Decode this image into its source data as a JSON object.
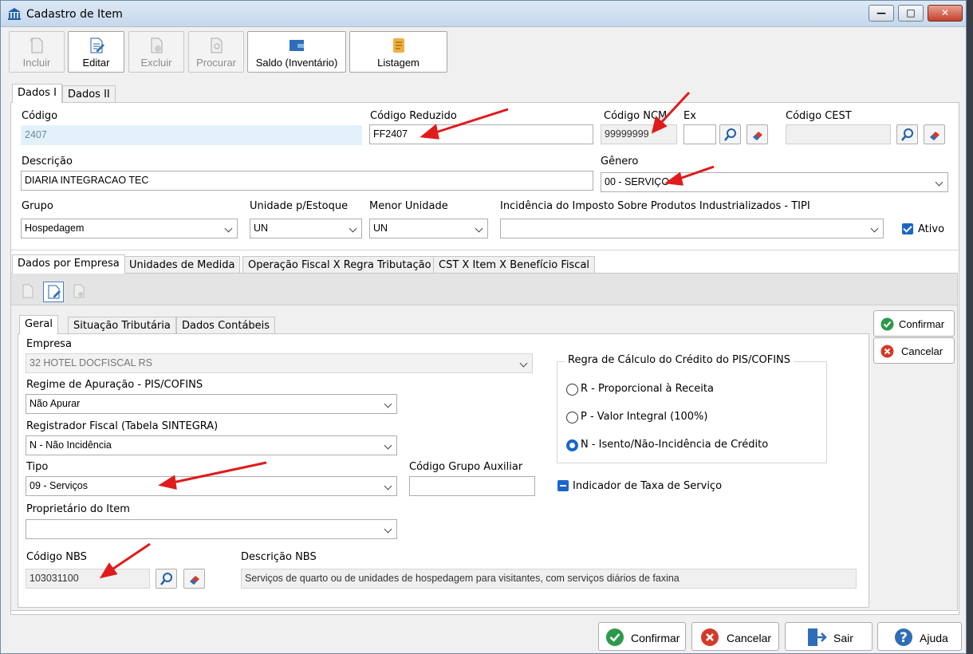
{
  "window": {
    "title": "Cadastro de Item"
  },
  "toolbar": {
    "incluir": "Incluir",
    "editar": "Editar",
    "excluir": "Excluir",
    "procurar": "Procurar",
    "saldo": "Saldo (Inventário)",
    "listagem": "Listagem"
  },
  "tabs_top": {
    "dados1": "Dados I",
    "dados2": "Dados II"
  },
  "form": {
    "codigo_label": "Código",
    "codigo": "2407",
    "cod_reduzido_label": "Código Reduzido",
    "cod_reduzido": "FF2407",
    "ncm_label": "Código NCM",
    "ncm": "99999999",
    "ex_label": "Ex",
    "ex": "",
    "cest_label": "Código CEST",
    "cest": "",
    "descricao_label": "Descrição",
    "descricao": "DIARIA INTEGRACAO TEC",
    "genero_label": "Gênero",
    "genero": "00 - SERVIÇO",
    "grupo_label": "Grupo",
    "grupo": "Hospedagem",
    "unidade_label": "Unidade p/Estoque",
    "unidade": "UN",
    "menor_label": "Menor Unidade",
    "menor": "UN",
    "tipi_label": "Incidência do Imposto Sobre Produtos Industrializados - TIPI",
    "tipi": "",
    "ativo_label": "Ativo",
    "ativo": true
  },
  "tabs_mid": [
    "Dados por Empresa",
    "Unidades de Medida",
    "Operação Fiscal X Regra Tributação",
    "CST X Item X Benefício Fiscal"
  ],
  "tabs_inner": [
    "Geral",
    "Situação Tributária",
    "Dados Contábeis"
  ],
  "geral": {
    "empresa_label": "Empresa",
    "empresa": "32 HOTEL DOCFISCAL RS",
    "regime_label": "Regime de Apuração - PIS/COFINS",
    "regime": "Não Apurar",
    "registrador_label": "Registrador Fiscal (Tabela SINTEGRA)",
    "registrador": "N - Não Incidência",
    "tipo_label": "Tipo",
    "tipo": "09 - Serviços",
    "grupo_aux_label": "Código Grupo Auxiliar",
    "grupo_aux": "",
    "proprietario_label": "Proprietário do Item",
    "proprietario": "",
    "nbs_label": "Código NBS",
    "nbs": "103031100",
    "desc_nbs_label": "Descrição NBS",
    "desc_nbs": "Serviços de quarto ou de unidades de hospedagem para visitantes, com serviços diários de faxina",
    "regra_title": "Regra de Cálculo do Crédito do PIS/COFINS",
    "regra_options": [
      "R - Proporcional à Receita",
      "P - Valor Integral (100%)",
      "N - Isento/Não-Incidência de Crédito"
    ],
    "regra_selected": 2,
    "indicador_label": "Indicador de Taxa de Serviço"
  },
  "side": {
    "confirmar": "Confirmar",
    "cancelar": "Cancelar"
  },
  "bottom": {
    "confirmar": "Confirmar",
    "cancelar": "Cancelar",
    "sair": "Sair",
    "ajuda": "Ajuda"
  },
  "colors": {
    "accent": "#1a66c8",
    "annotation": "#e01b1b",
    "confirm": "#2c9a4a",
    "cancel": "#d23a2a"
  }
}
